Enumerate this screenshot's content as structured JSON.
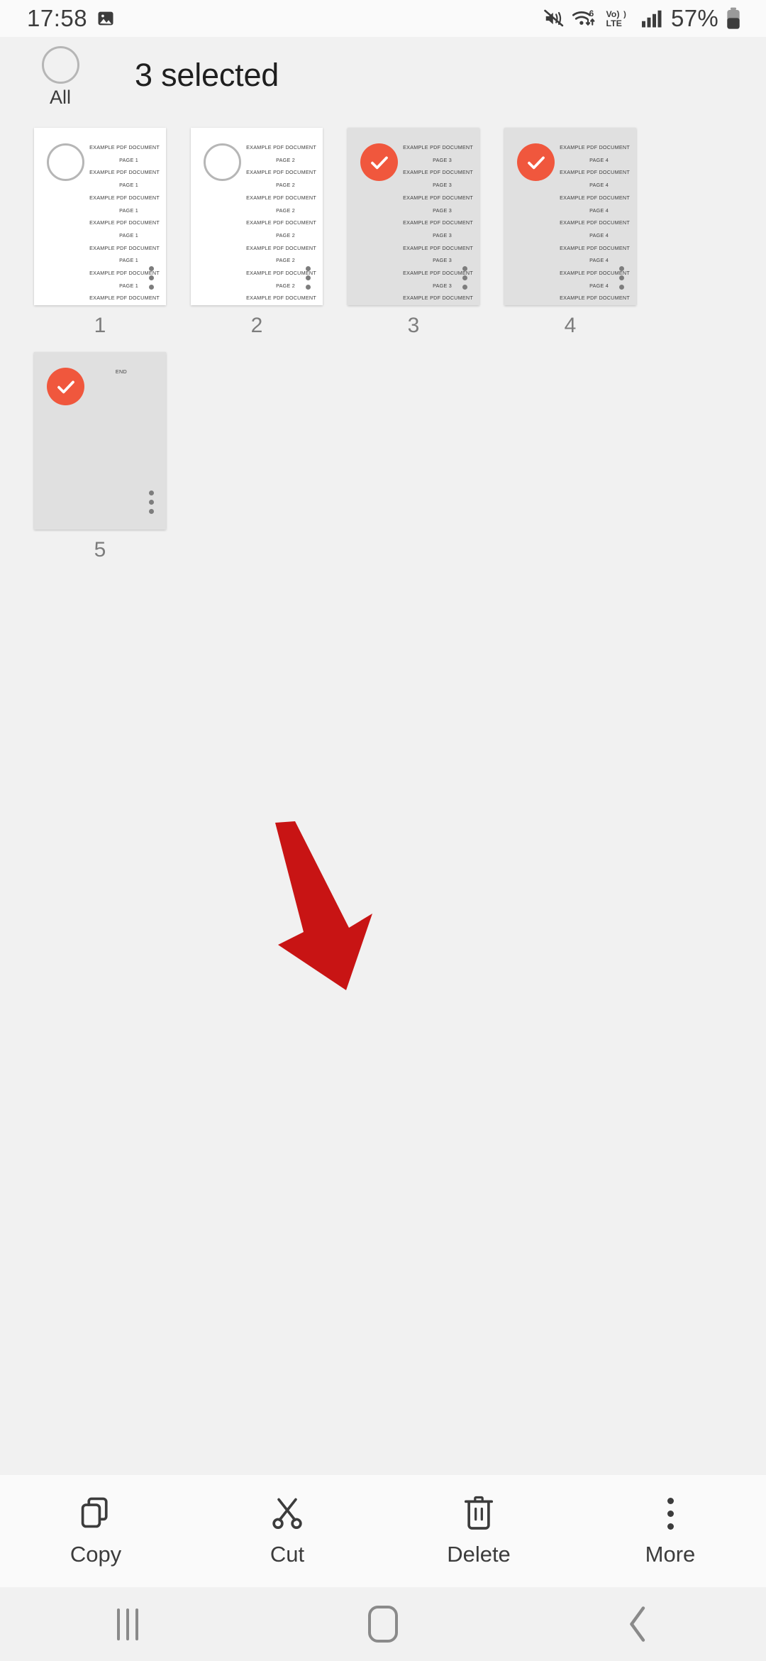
{
  "status_bar": {
    "time": "17:58",
    "battery_percent": "57%",
    "icons": [
      "image-icon",
      "mute-icon",
      "wifi-6-icon",
      "volte-lte-icon",
      "cellular-signal-icon",
      "battery-icon"
    ]
  },
  "header": {
    "all_label": "All",
    "title": "3 selected"
  },
  "pages": [
    {
      "label": "1",
      "selected": false,
      "doc_title": "EXAMPLE PDF DOCUMENT",
      "page_text": "PAGE 1",
      "line_count": 8,
      "is_end": false
    },
    {
      "label": "2",
      "selected": false,
      "doc_title": "EXAMPLE PDF DOCUMENT",
      "page_text": "PAGE 2",
      "line_count": 8,
      "is_end": false
    },
    {
      "label": "3",
      "selected": true,
      "doc_title": "EXAMPLE PDF DOCUMENT",
      "page_text": "PAGE 3",
      "line_count": 8,
      "is_end": false
    },
    {
      "label": "4",
      "selected": true,
      "doc_title": "EXAMPLE PDF DOCUMENT",
      "page_text": "PAGE 4",
      "line_count": 8,
      "is_end": false
    },
    {
      "label": "5",
      "selected": true,
      "doc_title": "",
      "page_text": "",
      "line_count": 0,
      "is_end": true,
      "end_text": "END"
    }
  ],
  "toolbar": {
    "items": [
      {
        "label": "Copy",
        "icon": "copy-icon"
      },
      {
        "label": "Cut",
        "icon": "scissors-icon"
      },
      {
        "label": "Delete",
        "icon": "trash-icon"
      },
      {
        "label": "More",
        "icon": "overflow-menu-icon"
      }
    ]
  },
  "nav_bar": {
    "recents": "recents-icon",
    "home": "home-icon",
    "back": "back-icon"
  },
  "annotation": {
    "arrow_color": "#c81414",
    "points_to": "Delete"
  },
  "colors": {
    "accent_selected": "#f0573d",
    "background": "#f1f1f1",
    "thumb_selected_bg": "#e0e0e0",
    "toolbar_bg": "#fafafa"
  }
}
